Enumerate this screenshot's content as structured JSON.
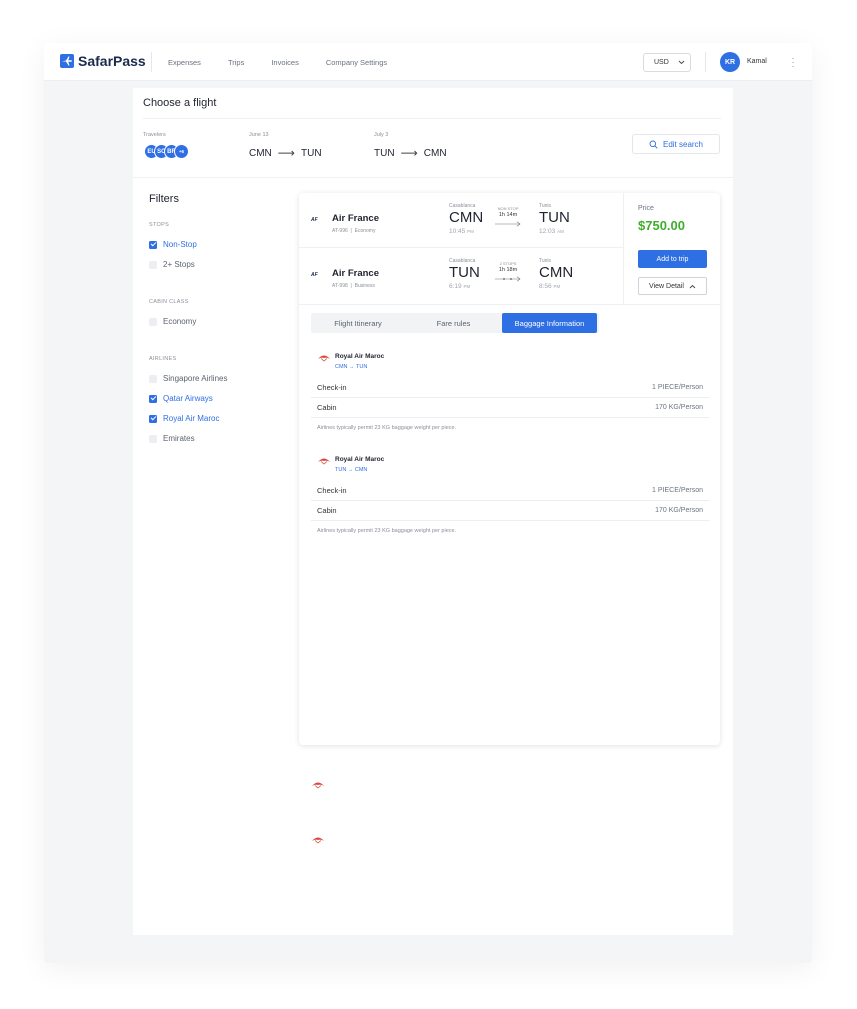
{
  "app": {
    "logo_text": "SafarPass"
  },
  "nav": {
    "items": [
      "Expenses",
      "Trips",
      "Invoices",
      "Company Settings"
    ]
  },
  "currency": {
    "value": "USD"
  },
  "user": {
    "initials": "KR",
    "name": "Kamal"
  },
  "page": {
    "title": "Choose a flight",
    "travelers_label": "Travelers",
    "travelers": [
      "EU",
      "SO",
      "BR",
      "+6"
    ],
    "outbound": {
      "date": "June 13",
      "from": "CMN",
      "to": "TUN"
    },
    "return": {
      "date": "July 3",
      "from": "TUN",
      "to": "CMN"
    },
    "edit_search": "Edit search"
  },
  "filters": {
    "title": "Filters",
    "stops": {
      "label": "STOPS",
      "options": [
        {
          "label": "Non-Stop",
          "checked": true
        },
        {
          "label": "2+ Stops",
          "checked": false
        }
      ]
    },
    "cabin": {
      "label": "CABIN CLASS",
      "options": [
        {
          "label": "Economy",
          "checked": false
        }
      ]
    },
    "airlines": {
      "label": "AIRLINES",
      "options": [
        {
          "label": "Singapore Airlines",
          "checked": false
        },
        {
          "label": "Qatar Airways",
          "checked": true
        },
        {
          "label": "Royal Air Maroc",
          "checked": true
        },
        {
          "label": "Emirates",
          "checked": false
        }
      ]
    }
  },
  "flight": {
    "legs": [
      {
        "logo": "AF",
        "airline": "Air France",
        "flight_no": "AT-996",
        "cabin": "Economy",
        "dep_city": "Casablanca",
        "dep_code": "CMN",
        "dep_time": "10:45",
        "dep_ampm": "PM",
        "stops": "NON STOP",
        "duration": "1h 14m",
        "arr_city": "Tunis",
        "arr_code": "TUN",
        "arr_time": "12:03",
        "arr_ampm": "AM"
      },
      {
        "logo": "AF",
        "airline": "Air France",
        "flight_no": "AT-998",
        "cabin": "Business",
        "dep_city": "Casablanca",
        "dep_code": "TUN",
        "dep_time": "6:19",
        "dep_ampm": "PM",
        "stops": "2 STOPS",
        "duration": "1h 18m",
        "arr_city": "Tunis",
        "arr_code": "CMN",
        "arr_time": "8:56",
        "arr_ampm": "PM"
      }
    ],
    "price_label": "Price",
    "price": "$750.00",
    "add_to_trip": "Add to trip",
    "view_detail": "View Detail"
  },
  "tabs": [
    {
      "label": "Flight Itinerary",
      "active": false
    },
    {
      "label": "Fare rules",
      "active": false
    },
    {
      "label": "Baggage Information",
      "active": true
    }
  ],
  "baggage": [
    {
      "airline": "Royal Air Maroc",
      "route": "CMN → TUN",
      "rows": [
        {
          "label": "Check-in",
          "value": "1 PIECE/Person"
        },
        {
          "label": "Cabin",
          "value": "170 KG/Person"
        }
      ],
      "note": "Airlines typically permit 23 KG baggage weight per piece."
    },
    {
      "airline": "Royal Air Maroc",
      "route": "TUN → CMN",
      "rows": [
        {
          "label": "Check-in",
          "value": "1 PIECE/Person"
        },
        {
          "label": "Cabin",
          "value": "170 KG/Person"
        }
      ],
      "note": "Airlines typically permit 23 KG baggage weight per piece."
    }
  ],
  "colors": {
    "accent": "#2f6fe4",
    "price": "#3fae2a",
    "ram_logo": "#d9473a"
  }
}
